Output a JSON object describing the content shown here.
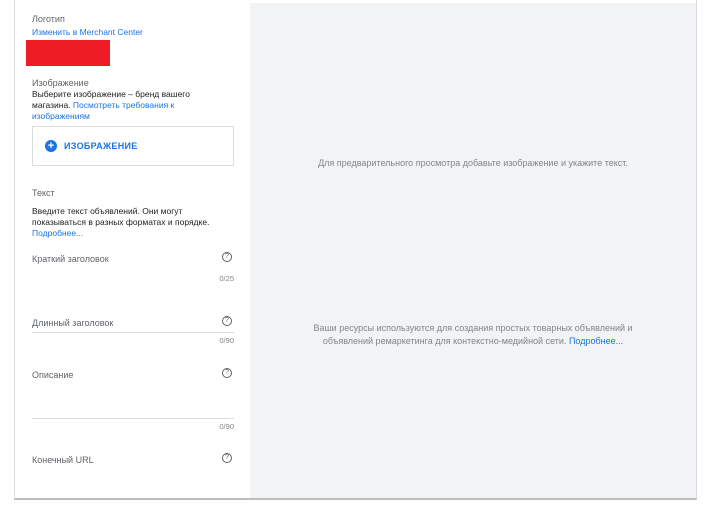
{
  "logo": {
    "label": "Логотип",
    "link": "Изменить в Merchant Center"
  },
  "image": {
    "label": "Изображение",
    "desc_line1": "Выберите изображение – бренд вашего",
    "desc_line2": "магазина.",
    "desc_link1": "Посмотреть требования к",
    "desc_link2": "изображениям",
    "button_label": "ИЗОБРАЖЕНИЕ",
    "button_icon": "plus-circle-icon"
  },
  "text": {
    "label": "Текст",
    "desc_line1": "Введите текст объявлений. Они могут",
    "desc_line2": "показываться в разных форматах и порядке.",
    "more_link": "Подробнее..."
  },
  "fields": {
    "short_title": {
      "label": "Краткий заголовок",
      "counter": "0/25"
    },
    "long_title": {
      "label": "Длинный заголовок",
      "counter": "0/90"
    },
    "description": {
      "label": "Описание",
      "counter": "0/90"
    },
    "final_url": {
      "label": "Конечный URL"
    }
  },
  "help_glyph": "?",
  "preview": {
    "hint": "Для предварительного просмотра добавьте изображение и укажите текст.",
    "info_line1": "Ваши ресурсы используются для создания простых товарных объявлений и",
    "info_line2": "объявлений ремаркетинга для контекстно-медийной сети.",
    "info_link": "Подробнее..."
  },
  "colors": {
    "accent": "#1a73e8",
    "logo_fill": "#ee1c25",
    "preview_bg": "#f1f3f4"
  }
}
